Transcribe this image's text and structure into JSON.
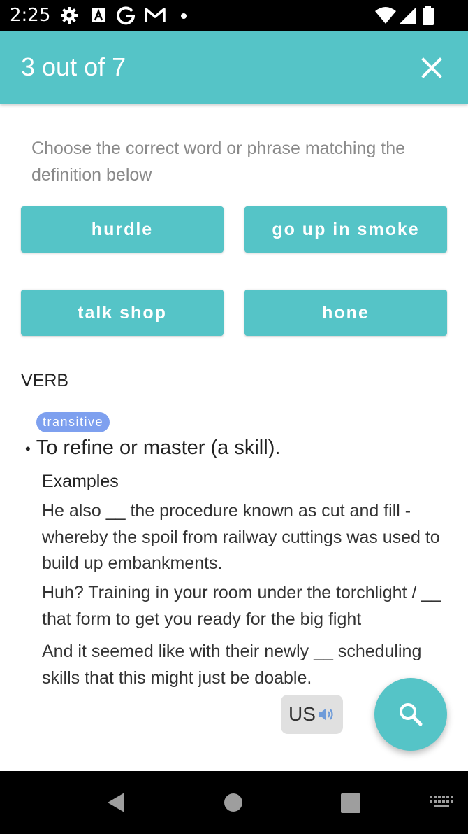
{
  "status_bar": {
    "time": "2:25",
    "left_icons": [
      "gear-icon",
      "a-box-icon",
      "google-g-icon",
      "gmail-icon",
      "dot-icon"
    ],
    "right_icons": [
      "wifi-icon",
      "signal-icon",
      "battery-icon"
    ]
  },
  "app_bar": {
    "title": "3 out of 7",
    "close_icon": "close-icon",
    "background": "#55c4c7"
  },
  "question": {
    "prompt": "Choose the correct word or phrase matching the definition below"
  },
  "options": [
    {
      "label": "hurdle"
    },
    {
      "label": "go up in smoke"
    },
    {
      "label": "talk shop"
    },
    {
      "label": "hone"
    }
  ],
  "definition": {
    "part_of_speech": "VERB",
    "badge": "transitive",
    "badge_color": "#7ea0ef",
    "bullet": "•",
    "text": "To refine or master (a skill).",
    "examples_heading": "Examples",
    "examples": [
      "He also __ the procedure known as cut and fill - whereby the spoil from railway cuttings was used to build up embankments.",
      "Huh? Training in your room under the torchlight / __ that form to get you ready for the big fight",
      "And it seemed like with their newly __ scheduling skills that this might just be doable."
    ]
  },
  "pronunciation": {
    "label": "US",
    "icon": "speaker-icon"
  },
  "fab": {
    "icon": "search-icon"
  },
  "nav_bar": {
    "icons": [
      "back-icon",
      "home-icon",
      "recents-icon",
      "keyboard-icon"
    ]
  }
}
